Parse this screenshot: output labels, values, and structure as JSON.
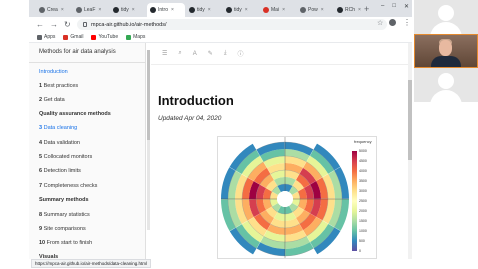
{
  "browser": {
    "tabs": [
      {
        "label": "Crea",
        "icon": "generic-icon",
        "active": false
      },
      {
        "label": "LeaF",
        "icon": "generic-icon",
        "active": false
      },
      {
        "label": "tidy",
        "icon": "github-icon",
        "active": false
      },
      {
        "label": "Intro",
        "icon": "github-icon",
        "active": true
      },
      {
        "label": "tidy",
        "icon": "github-icon",
        "active": false
      },
      {
        "label": "tidy",
        "icon": "github-icon",
        "active": false
      },
      {
        "label": "Mai",
        "icon": "mail-icon",
        "active": false
      },
      {
        "label": "Pow",
        "icon": "generic-icon",
        "active": false
      },
      {
        "label": "RCh",
        "icon": "github-icon",
        "active": false
      }
    ],
    "new_tab": "+",
    "window_controls": [
      "–",
      "□",
      "✕"
    ],
    "url": "mpca-air.github.io/air-methods/",
    "bookmarks": [
      {
        "label": "Apps",
        "color": "#5f6368"
      },
      {
        "label": "Gmail",
        "color": "#d93025"
      },
      {
        "label": "YouTube",
        "color": "#ff0000"
      },
      {
        "label": "Maps",
        "color": "#34a853"
      }
    ],
    "status_url": "https://mpca-air.github.io/air-methods/data-cleaning.html"
  },
  "sidebar": {
    "title": "Methods for air data analysis",
    "items": [
      {
        "label": "Introduction",
        "number": "",
        "active": true,
        "heading": false
      },
      {
        "label": "Best practices",
        "number": "1",
        "active": false,
        "heading": false
      },
      {
        "label": "Get data",
        "number": "2",
        "active": false,
        "heading": false
      },
      {
        "label": "Quality assurance methods",
        "number": "",
        "active": false,
        "heading": true
      },
      {
        "label": "Data cleaning",
        "number": "3",
        "active": true,
        "heading": false
      },
      {
        "label": "Data validation",
        "number": "4",
        "active": false,
        "heading": false
      },
      {
        "label": "Collocated monitors",
        "number": "5",
        "active": false,
        "heading": false
      },
      {
        "label": "Detection limits",
        "number": "6",
        "active": false,
        "heading": false
      },
      {
        "label": "Completeness checks",
        "number": "7",
        "active": false,
        "heading": false
      },
      {
        "label": "Summary methods",
        "number": "",
        "active": false,
        "heading": true
      },
      {
        "label": "Summary statistics",
        "number": "8",
        "active": false,
        "heading": false
      },
      {
        "label": "Site comparisons",
        "number": "9",
        "active": false,
        "heading": false
      },
      {
        "label": "From start to finish",
        "number": "10",
        "active": false,
        "heading": false
      },
      {
        "label": "Visuals",
        "number": "",
        "active": false,
        "heading": true
      }
    ]
  },
  "content": {
    "toolbar_icons": [
      "menu-icon",
      "search-icon",
      "font-icon",
      "edit-icon",
      "download-icon",
      "info-icon"
    ],
    "title": "Introduction",
    "subtitle": "Updated Apr 04, 2020"
  },
  "figure": {
    "legend_title": "frequency",
    "legend_ticks": [
      "5000",
      "4500",
      "4000",
      "3500",
      "3000",
      "2500",
      "2000",
      "1500",
      "1000",
      "500",
      "0"
    ],
    "colors": [
      "#5e4fa2",
      "#3288bd",
      "#66c2a5",
      "#abdda4",
      "#e6f598",
      "#fee08b",
      "#fdae61",
      "#f46d43",
      "#d53e4f",
      "#9e0142"
    ]
  }
}
